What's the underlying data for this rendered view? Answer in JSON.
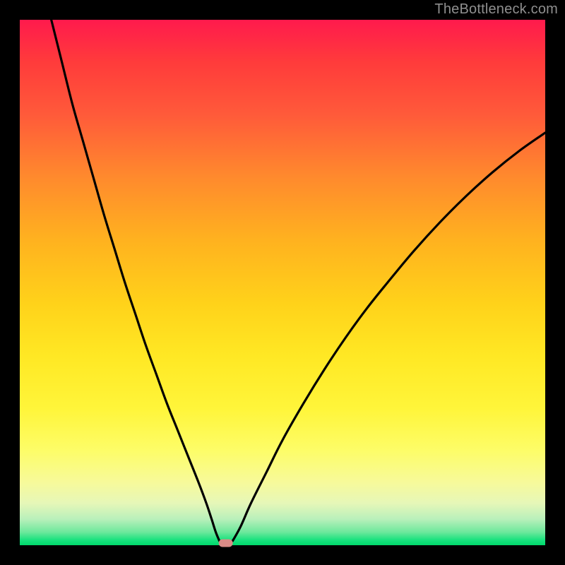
{
  "watermark": "TheBottleneck.com",
  "colors": {
    "frame": "#000000",
    "curve_stroke": "#000000",
    "marker_fill": "#d98b86",
    "gradient_top": "#ff1a4d",
    "gradient_bottom": "#00d96b"
  },
  "chart_data": {
    "type": "line",
    "title": "",
    "xlabel": "",
    "ylabel": "",
    "xlim": [
      0,
      100
    ],
    "ylim": [
      0,
      100
    ],
    "grid": false,
    "annotations": [
      {
        "text": "TheBottleneck.com",
        "position": "top-right"
      }
    ],
    "series": [
      {
        "name": "left-branch",
        "x": [
          6,
          8,
          10,
          12,
          14,
          16,
          18,
          20,
          22,
          24,
          26,
          28,
          30,
          32,
          34,
          35.5,
          36.5,
          37.3,
          38.0
        ],
        "y": [
          100,
          92,
          84,
          77,
          70,
          63,
          56.5,
          50,
          44,
          38,
          32.5,
          27,
          22,
          17,
          12,
          8,
          5,
          2.5,
          0.8
        ]
      },
      {
        "name": "right-branch",
        "x": [
          40.5,
          42,
          44,
          47,
          50,
          54,
          58,
          62,
          66,
          70,
          75,
          80,
          85,
          90,
          95,
          100
        ],
        "y": [
          0.8,
          3.5,
          8,
          14,
          20,
          27,
          33.5,
          39.5,
          45,
          50,
          56,
          61.5,
          66.5,
          71,
          75,
          78.5
        ]
      }
    ],
    "marker": {
      "x": 39.2,
      "y": 0.4,
      "shape": "rounded-rect"
    }
  }
}
